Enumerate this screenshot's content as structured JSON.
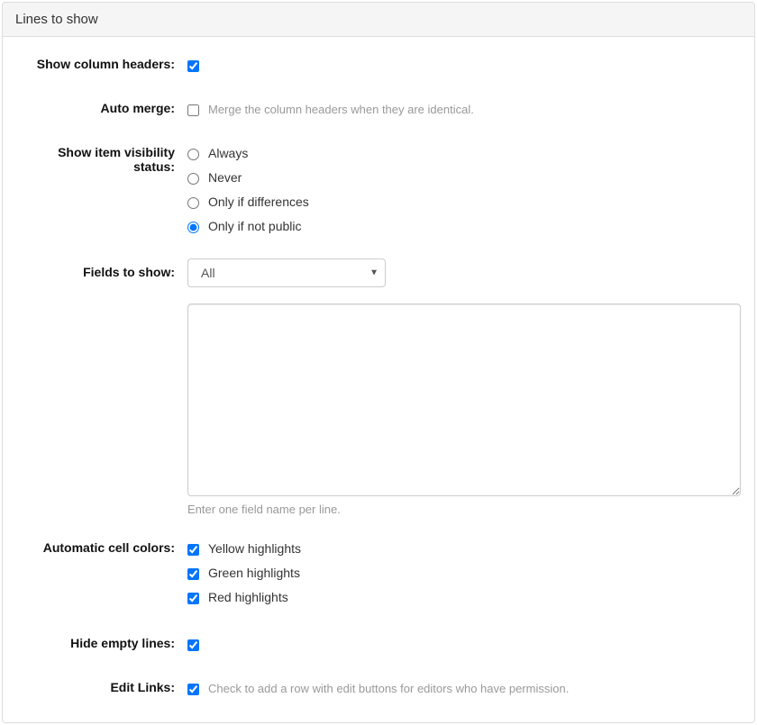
{
  "panel": {
    "title": "Lines to show"
  },
  "fields": {
    "show_column_headers": {
      "label": "Show column headers:",
      "checked": true
    },
    "auto_merge": {
      "label": "Auto merge:",
      "checked": false,
      "description": "Merge the column headers when they are identical."
    },
    "visibility": {
      "label": "Show item visibility status:",
      "selected": "only_if_not_public",
      "options": {
        "always": "Always",
        "never": "Never",
        "only_if_diff": "Only if differences",
        "only_if_not_public": "Only if not public"
      }
    },
    "fields_to_show": {
      "label": "Fields to show:",
      "select_value": "All",
      "textarea_value": "",
      "help": "Enter one field name per line."
    },
    "auto_colors": {
      "label": "Automatic cell colors:",
      "yellow": {
        "label": "Yellow highlights",
        "checked": true
      },
      "green": {
        "label": "Green highlights",
        "checked": true
      },
      "red": {
        "label": "Red highlights",
        "checked": true
      }
    },
    "hide_empty": {
      "label": "Hide empty lines:",
      "checked": true
    },
    "edit_links": {
      "label": "Edit Links:",
      "checked": true,
      "description": "Check to add a row with edit buttons for editors who have permission."
    }
  }
}
